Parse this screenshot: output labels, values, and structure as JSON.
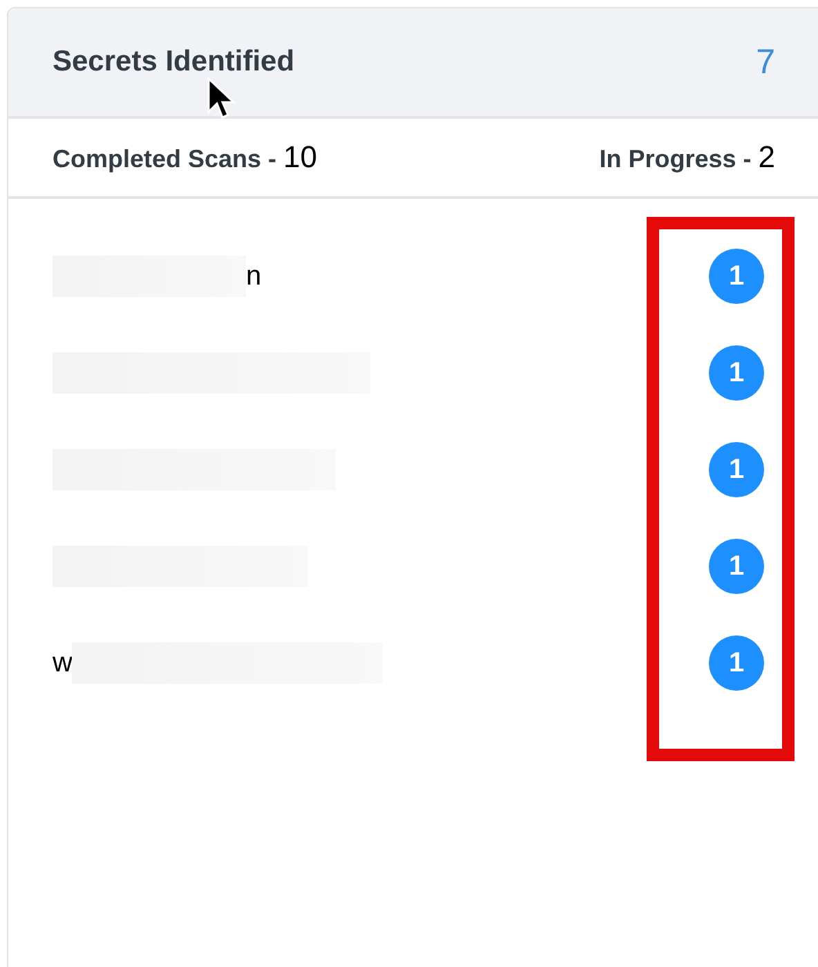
{
  "header": {
    "title": "Secrets Identified",
    "count": "7"
  },
  "stats": [
    {
      "label": "Completed Scans - ",
      "value": "10"
    },
    {
      "label": "In Progress - ",
      "value": "2"
    }
  ],
  "repositories": [
    {
      "text_after": "n",
      "count": "1"
    },
    {
      "count": "1"
    },
    {
      "count": "1"
    },
    {
      "count": "1"
    },
    {
      "text_before": "w",
      "count": "1"
    }
  ]
}
